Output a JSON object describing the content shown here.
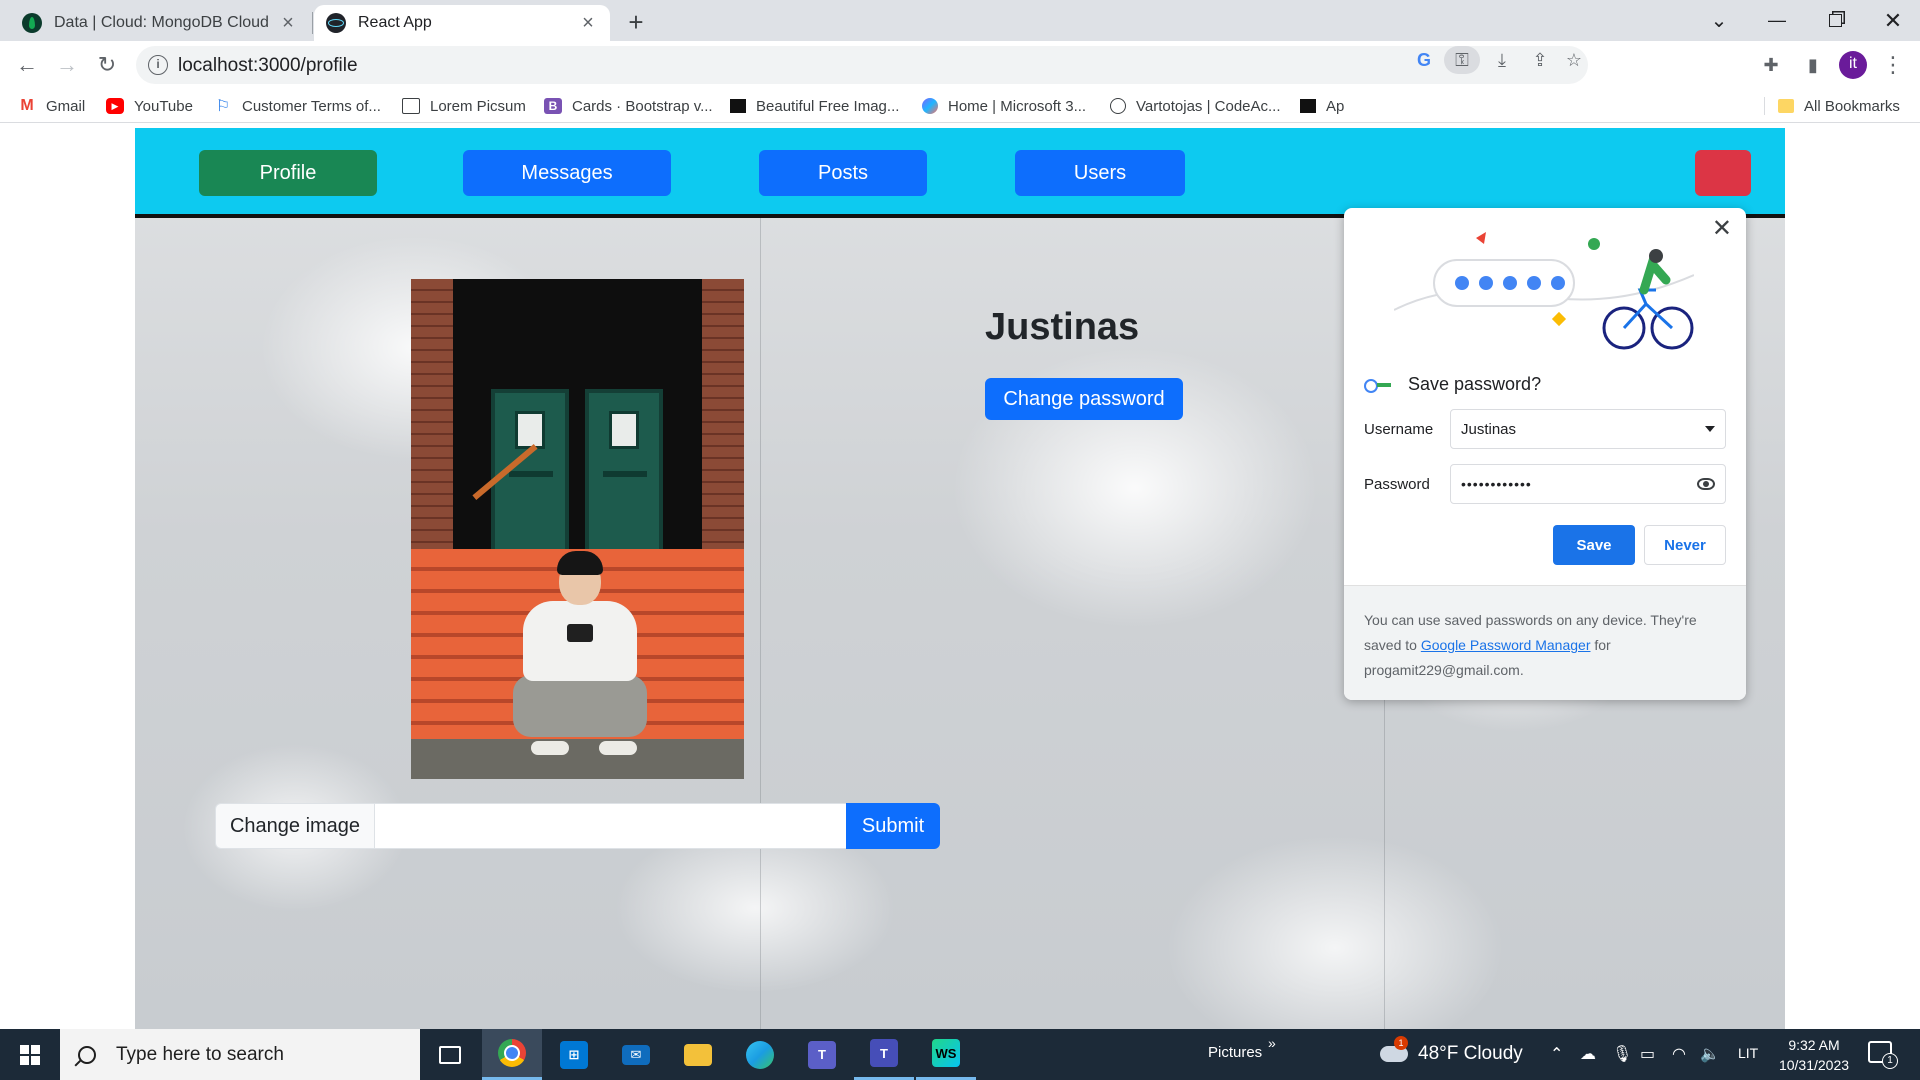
{
  "browser": {
    "tabs": [
      {
        "title": "Data | Cloud: MongoDB Cloud",
        "favicon": "mongodb-leaf-icon",
        "active": false
      },
      {
        "title": "React App",
        "favicon": "react-icon",
        "active": true
      }
    ],
    "url": "localhost:3000/profile",
    "avatar_letter": "it",
    "bookmarks": [
      {
        "label": "Gmail",
        "icon": "gmail-icon"
      },
      {
        "label": "YouTube",
        "icon": "youtube-icon"
      },
      {
        "label": "Customer Terms of...",
        "icon": "flag-icon"
      },
      {
        "label": "Lorem Picsum",
        "icon": "image-icon"
      },
      {
        "label": "Cards · Bootstrap v...",
        "icon": "bootstrap-icon"
      },
      {
        "label": "Beautiful Free Imag...",
        "icon": "unsplash-icon"
      },
      {
        "label": "Home | Microsoft 3...",
        "icon": "microsoft365-icon"
      },
      {
        "label": "Vartotojas | CodeAc...",
        "icon": "codeacademy-icon"
      },
      {
        "label": "Ap",
        "icon": "unsplash-icon"
      }
    ],
    "all_bookmarks_label": "All Bookmarks"
  },
  "app": {
    "nav": {
      "profile": "Profile",
      "messages": "Messages",
      "posts": "Posts",
      "users": "Users"
    },
    "profile": {
      "username": "Justinas",
      "change_password_label": "Change password",
      "change_image_label": "Change image",
      "submit_label": "Submit",
      "image_input_value": ""
    },
    "colors": {
      "navbar_bg": "#0dcaf0",
      "profile_btn": "#198754",
      "primary_btn": "#0d6efd",
      "danger_btn": "#dc3545"
    }
  },
  "password_bubble": {
    "title": "Save password?",
    "username_label": "Username",
    "username_value": "Justinas",
    "password_label": "Password",
    "password_mask": "••••••••••••",
    "save_label": "Save",
    "never_label": "Never",
    "footer_pre": "You can use saved passwords on any device. They're saved to ",
    "footer_link": "Google Password Manager",
    "footer_post": " for progamit229@gmail.com."
  },
  "taskbar": {
    "search_placeholder": "Type here to search",
    "pictures_label": "Pictures",
    "weather": "48°F  Cloudy",
    "weather_badge": "1",
    "language": "LIT",
    "time": "9:32 AM",
    "date": "10/31/2023",
    "notification_count": "1"
  }
}
